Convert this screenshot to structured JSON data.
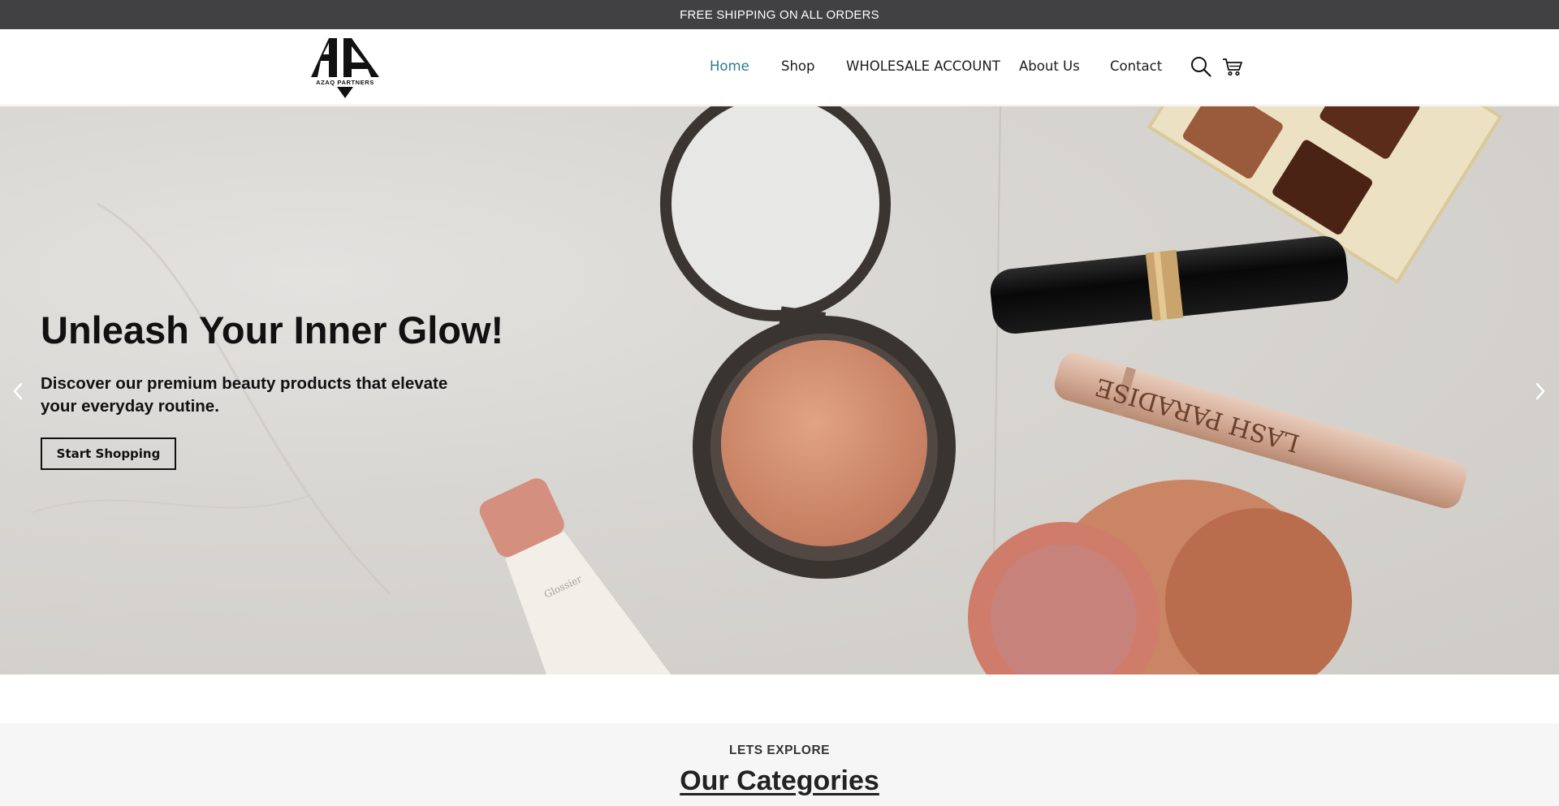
{
  "announcement": {
    "text": "FREE SHIPPING ON ALL ORDERS"
  },
  "brand": {
    "logo_text": "AZAQ PARTNERS"
  },
  "nav": {
    "items": [
      {
        "label": "Home",
        "active": true
      },
      {
        "label": "Shop",
        "active": false
      },
      {
        "label": "WHOLESALE ACCOUNT",
        "active": false
      },
      {
        "label": "About Us",
        "active": false
      },
      {
        "label": "Contact",
        "active": false
      }
    ],
    "icons": [
      "search-icon",
      "cart-icon"
    ]
  },
  "hero": {
    "title": "Unleash Your Inner Glow!",
    "subtitle": "Discover our premium beauty products that elevate your everyday routine.",
    "button_label": "Start Shopping",
    "prev_icon": "chevron-left-icon",
    "next_icon": "chevron-right-icon"
  },
  "categories": {
    "kicker": "LETS EXPLORE",
    "title": "Our Categories"
  },
  "colors": {
    "announcement_bg": "#414144",
    "nav_active": "#2a7a97",
    "categories_bg": "#f6f6f6"
  }
}
